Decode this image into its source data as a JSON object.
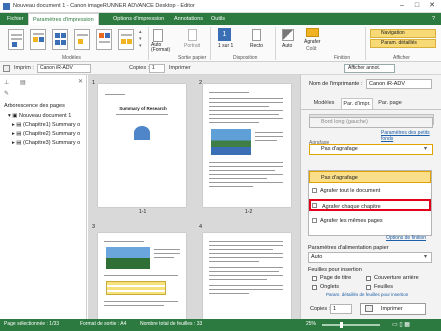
{
  "window": {
    "title": "Nouveau document 1 - Canon imageRUNNER ADVANCE Desktop - Editor",
    "minimize": "–",
    "maximize": "□",
    "close": "✕"
  },
  "menubar": {
    "items": [
      "Fichier",
      "Paramètres d'impression",
      "Options d'impression",
      "Annotations",
      "Outils"
    ],
    "active_index": 1,
    "help": "?"
  },
  "ribbon": {
    "groups": {
      "modeles": "Modèles",
      "sortie_papier": "Sortie papier",
      "disposition": "Disposition",
      "finition": "Finition",
      "afficher": "Afficher"
    },
    "auto_format": "Auto (Format)",
    "portrait": "Portrait",
    "count": "1",
    "sur": "1 sur 1",
    "recto": "Recto",
    "auto_color": "Auto",
    "agrafer": "Agrafer",
    "cout": "Coût",
    "navigation": "Navigation",
    "param_details": "Param. détaillés"
  },
  "toolbar": {
    "imprim_label": "Imprim :",
    "printer_value": "Canon iR-ADV",
    "copies_label": "Copies :",
    "copies_value": "1",
    "imprimer_label": "Imprimer",
    "afficher_annot": "Afficher annot."
  },
  "left_panel": {
    "tree_header": "Arborescence des pages",
    "tree": [
      {
        "label": "Nouveau document 1",
        "level": 0
      },
      {
        "label": "(Chapitre1) Summary o",
        "level": 1
      },
      {
        "label": "(Chapitre2) Summary o",
        "level": 1
      },
      {
        "label": "(Chapitre3) Summary o",
        "level": 1
      }
    ]
  },
  "canvas": {
    "page_numbers": [
      "1",
      "2",
      "3",
      "4"
    ],
    "page_labels": [
      "1-1",
      "1-2"
    ],
    "page1_title": "Summary of Research"
  },
  "right_panel": {
    "printer_label": "Nom de l'imprimante :",
    "printer_value": "Canon iR-ADV",
    "tabs": [
      "Modèles",
      "Par. d'impr.",
      "Par. page"
    ],
    "active_tab": 1,
    "binding_value": "Bord long (gauche)",
    "petits_fonds_link": "Paramètres des petits fonds",
    "stapling_selected": "Pas d'agrafage",
    "stapling_options": [
      "Pas d'agrafage",
      "Agrafer tout le document",
      "Agrafer chaque chapitre",
      "Agrafer les mêmes pages"
    ],
    "highlighted_option_index": 2,
    "finition_link": "Options de finition",
    "alimentation_label": "Paramètres d'alimentation papier",
    "alimentation_value": "Auto",
    "feuilles_label": "Feuilles pour insertion",
    "page_titre": "Page de titre",
    "couverture": "Couverture arrière",
    "onglets": "Onglets",
    "feuilles": "Feuilles",
    "params_link": "Param. détaillés de feuilles pour insertion",
    "copies_label": "Copies :",
    "copies_value": "1",
    "imprimer_button": "Imprimer",
    "stapling_header": "Agrafage"
  },
  "statusbar": {
    "page_selected": "Page sélectionnée : 1/33",
    "format": "Format de sortie : A4",
    "total_pages": "Nombre total de feuilles : 33",
    "zoom": "25%"
  },
  "colors": {
    "brand_green": "#2c7a3f",
    "highlight_red": "#e3001b",
    "staple_orange": "#f2b322"
  }
}
